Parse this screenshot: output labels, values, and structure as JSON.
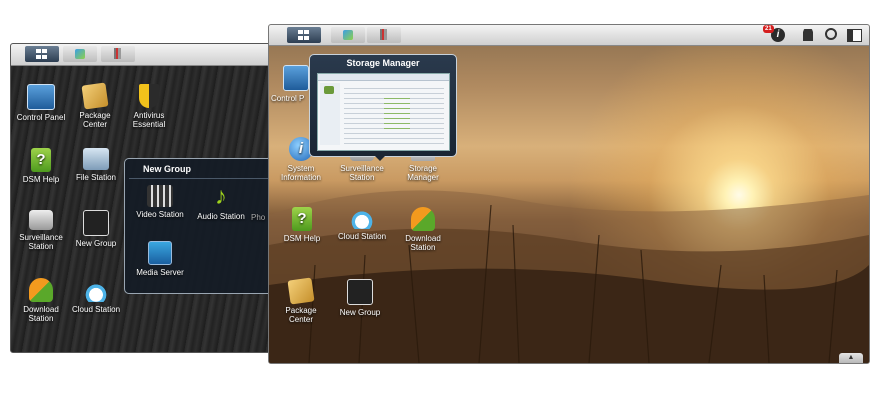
{
  "back_desktop": {
    "icons": [
      {
        "label": "Control Panel",
        "icon": "control-panel-icon"
      },
      {
        "label": "Package Center",
        "icon": "package-center-icon"
      },
      {
        "label": "Antivirus Essential",
        "icon": "antivirus-icon"
      },
      {
        "label": "DSM Help",
        "icon": "help-icon"
      },
      {
        "label": "File Station",
        "icon": "file-station-icon"
      },
      {
        "label": "Surveillance Station",
        "icon": "surveillance-icon"
      },
      {
        "label": "New Group",
        "icon": "group-icon"
      },
      {
        "label": "Download Station",
        "icon": "download-icon"
      },
      {
        "label": "Cloud Station",
        "icon": "cloud-icon"
      }
    ]
  },
  "new_group_popup": {
    "title": "New Group",
    "items": [
      {
        "label": "Video Station",
        "icon": "video-station-icon"
      },
      {
        "label": "Audio Station",
        "icon": "audio-station-icon"
      },
      {
        "label": "Pho",
        "icon": "photo-station-icon"
      },
      {
        "label": "Media Server",
        "icon": "media-server-icon"
      }
    ]
  },
  "front_desktop": {
    "notification_count": "21",
    "storage_thumb_title": "Storage Manager",
    "icons": [
      {
        "label": "Control P",
        "icon": "control-panel-icon"
      },
      {
        "label": "System Information",
        "icon": "info-icon"
      },
      {
        "label": "Surveillance Station",
        "icon": "surveillance-icon"
      },
      {
        "label": "Storage Manager",
        "icon": "storage-icon"
      },
      {
        "label": "DSM Help",
        "icon": "help-icon"
      },
      {
        "label": "Cloud Station",
        "icon": "cloud-icon"
      },
      {
        "label": "Download Station",
        "icon": "download-icon"
      },
      {
        "label": "Package Center",
        "icon": "package-center-icon"
      },
      {
        "label": "New Group",
        "icon": "group-icon"
      }
    ]
  }
}
